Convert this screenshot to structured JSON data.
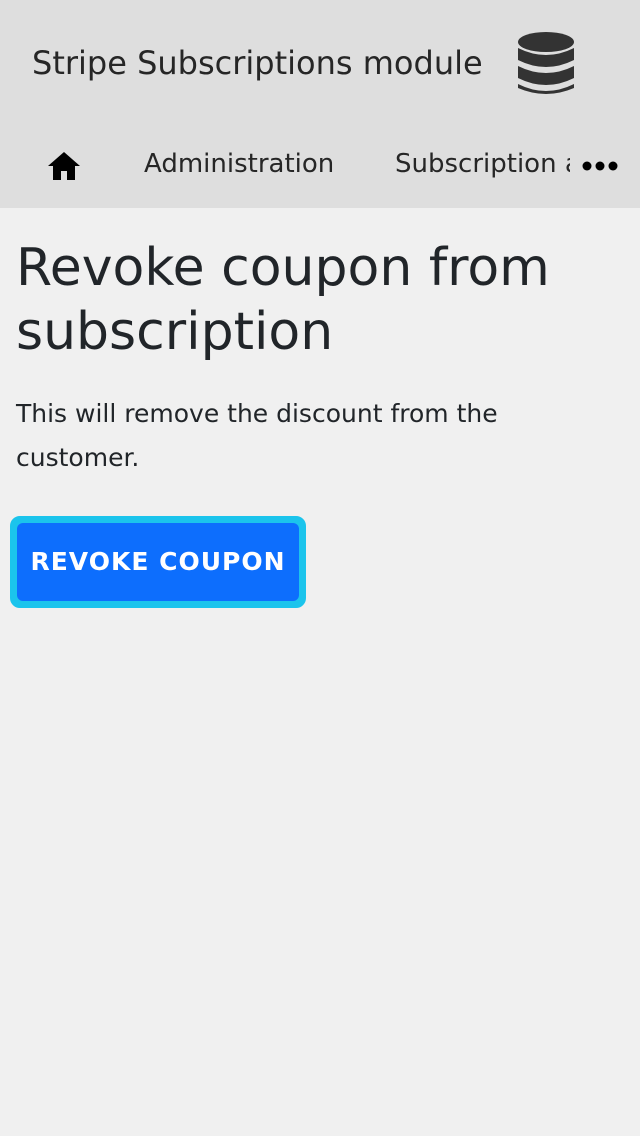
{
  "header": {
    "app_title": "Stripe Subscriptions module",
    "app_icon": "database-icon"
  },
  "nav": {
    "home_icon": "home-icon",
    "items": [
      {
        "label": "Administration"
      },
      {
        "label": "Subscription a"
      }
    ],
    "more_icon": "more-horizontal-icon"
  },
  "main": {
    "title": "Revoke coupon from subscription",
    "description": "This will remove the discount from the customer.",
    "revoke_button_label": "REVOKE COUPON"
  },
  "colors": {
    "header_bg": "#dedede",
    "page_bg": "#f0f0f0",
    "primary": "#0d6efd",
    "focus_ring": "#1bc4ec"
  }
}
